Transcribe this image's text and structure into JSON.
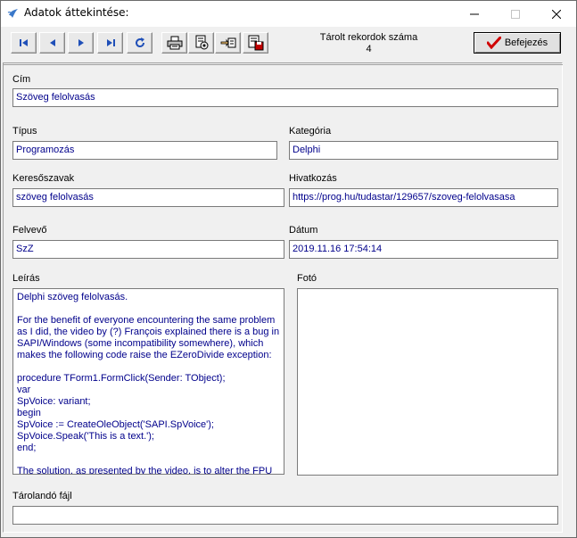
{
  "window": {
    "title": "Adatok áttekintése:",
    "controls": {
      "minimize": "—",
      "maximize": "☐",
      "close": "✕"
    }
  },
  "toolbar": {
    "buttons": [
      {
        "name": "first-record-icon"
      },
      {
        "name": "prev-record-icon"
      },
      {
        "name": "next-record-icon"
      },
      {
        "name": "last-record-icon"
      },
      {
        "name": "refresh-icon"
      },
      {
        "name": "print-icon"
      },
      {
        "name": "report-icon"
      },
      {
        "name": "hand-pointer-icon"
      },
      {
        "name": "save-document-icon"
      }
    ],
    "record_count_label": "Tárolt rekordok száma",
    "record_count": "4",
    "finish_label": "Befejezés",
    "finish_color": "#d00000"
  },
  "form": {
    "title": {
      "label": "Cím",
      "value": "Szöveg felolvasás"
    },
    "type": {
      "label": "Típus",
      "value": "Programozás"
    },
    "category": {
      "label": "Kategória",
      "value": "Delphi"
    },
    "keywords": {
      "label": "Keresőszavak",
      "value": "szöveg felolvasás"
    },
    "reference": {
      "label": "Hivatkozás",
      "value": "https://prog.hu/tudastar/129657/szoveg-felolvasasa"
    },
    "recorder": {
      "label": "Felvevő",
      "value": "SzZ"
    },
    "date": {
      "label": "Dátum",
      "value": "2019.11.16 17:54:14"
    },
    "description": {
      "label": "Leírás",
      "value": "Delphi szöveg felolvasás.\n\nFor the benefit of everyone encountering the same problem\nas I did, the video by (?) François explained there is a bug in\nSAPI/Windows (some incompatibility somewhere), which\nmakes the following code raise the EZeroDivide exception:\n\nprocedure TForm1.FormClick(Sender: TObject);\nvar\nSpVoice: variant;\nbegin\nSpVoice := CreateOleObject('SAPI.SpVoice');\nSpVoice.Speak('This is a text.');\nend;\n\nThe solution, as presented by the video, is to alter the FPU"
    },
    "photo": {
      "label": "Fotó"
    },
    "file": {
      "label": "Tárolandó fájl",
      "value": ""
    }
  }
}
